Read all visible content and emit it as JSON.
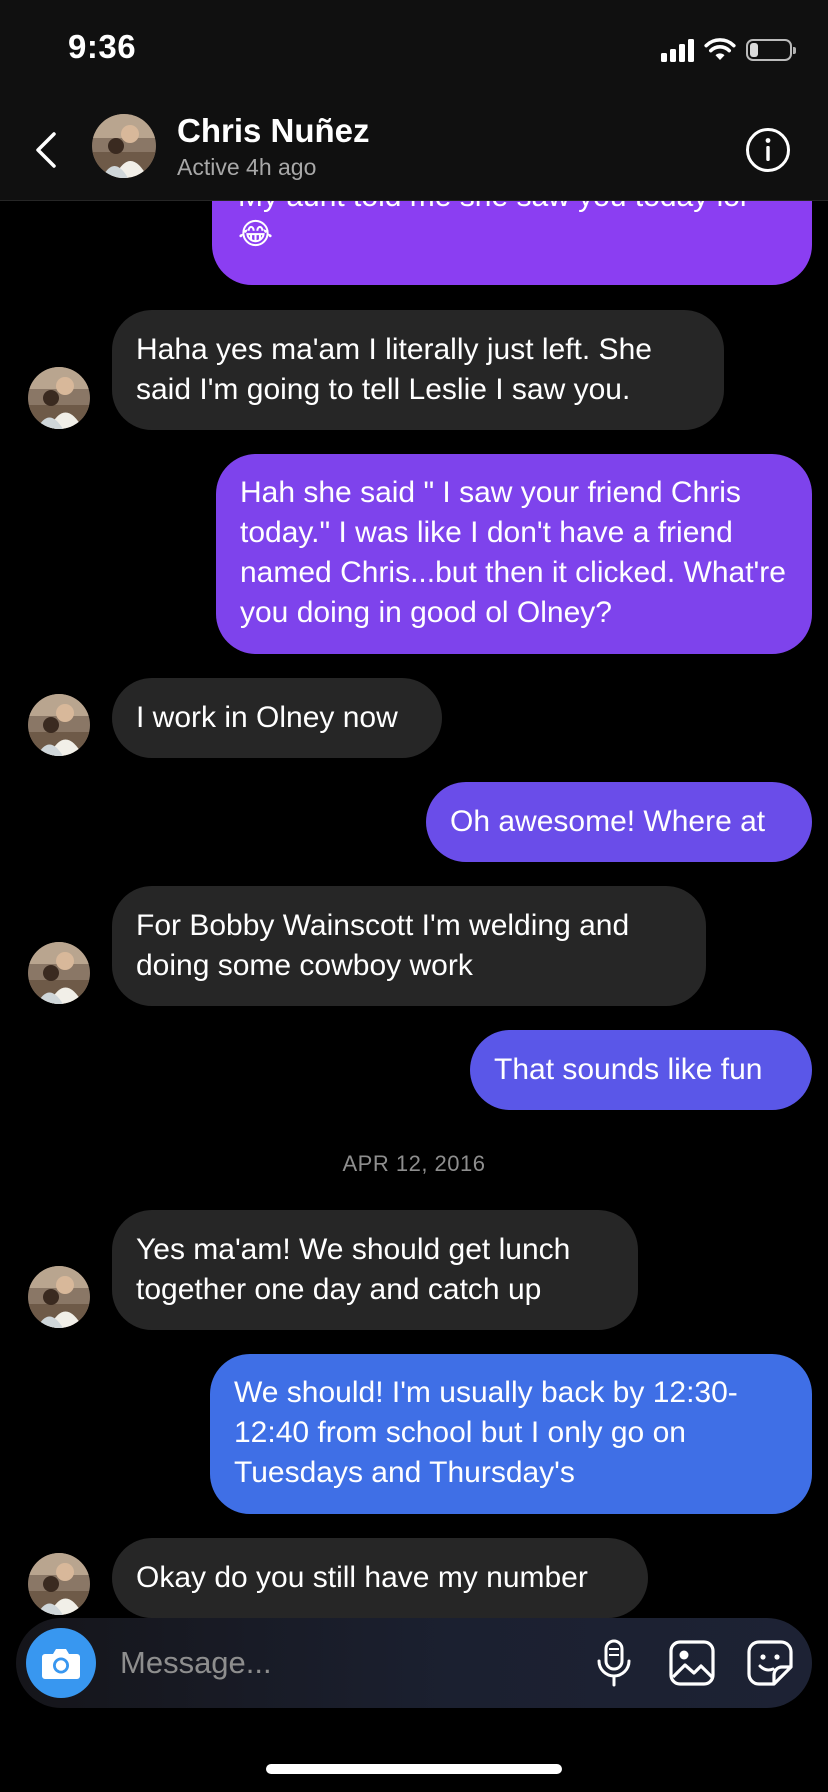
{
  "status_bar": {
    "time": "9:36",
    "battery_level": 0.2
  },
  "header": {
    "contact_name": "Chris Nuñez",
    "active_status": "Active 4h ago",
    "icons": {
      "back": "chevron-left-icon",
      "info": "info-circle-icon"
    }
  },
  "colors": {
    "incoming_bubble": "#262626",
    "outgoing_bubble_purple": "#8b3ef2",
    "outgoing_bubble_blue": "#3f6fe6",
    "camera_button": "#3897f0"
  },
  "messages": [
    {
      "direction": "out",
      "text": "My aunt told me she saw you today lol 😂"
    },
    {
      "direction": "in",
      "text": "Haha yes ma'am I literally just left. She said I'm going to tell Leslie I saw you."
    },
    {
      "direction": "out",
      "text": "Hah she said \" I saw your friend Chris today.\" I was like I don't have a friend named Chris...but then it clicked. What're you doing in good ol Olney?"
    },
    {
      "direction": "in",
      "text": "I work in Olney now"
    },
    {
      "direction": "out",
      "text": "Oh awesome! Where at"
    },
    {
      "direction": "in",
      "text": "For Bobby Wainscott I'm welding and doing some cowboy work"
    },
    {
      "direction": "out",
      "text": "That sounds like fun"
    },
    {
      "direction": "in",
      "text": "Yes ma'am! We should get lunch together one day and catch up"
    },
    {
      "direction": "out",
      "text": "We should! I'm usually back by 12:30-12:40 from school but I only go on Tuesdays and Thursday's"
    },
    {
      "direction": "in",
      "text": "Okay do you still have my number"
    }
  ],
  "date_separator": "APR 12, 2016",
  "composer": {
    "placeholder": "Message...",
    "icons": [
      "camera-icon",
      "microphone-icon",
      "gallery-icon",
      "sticker-icon"
    ]
  }
}
